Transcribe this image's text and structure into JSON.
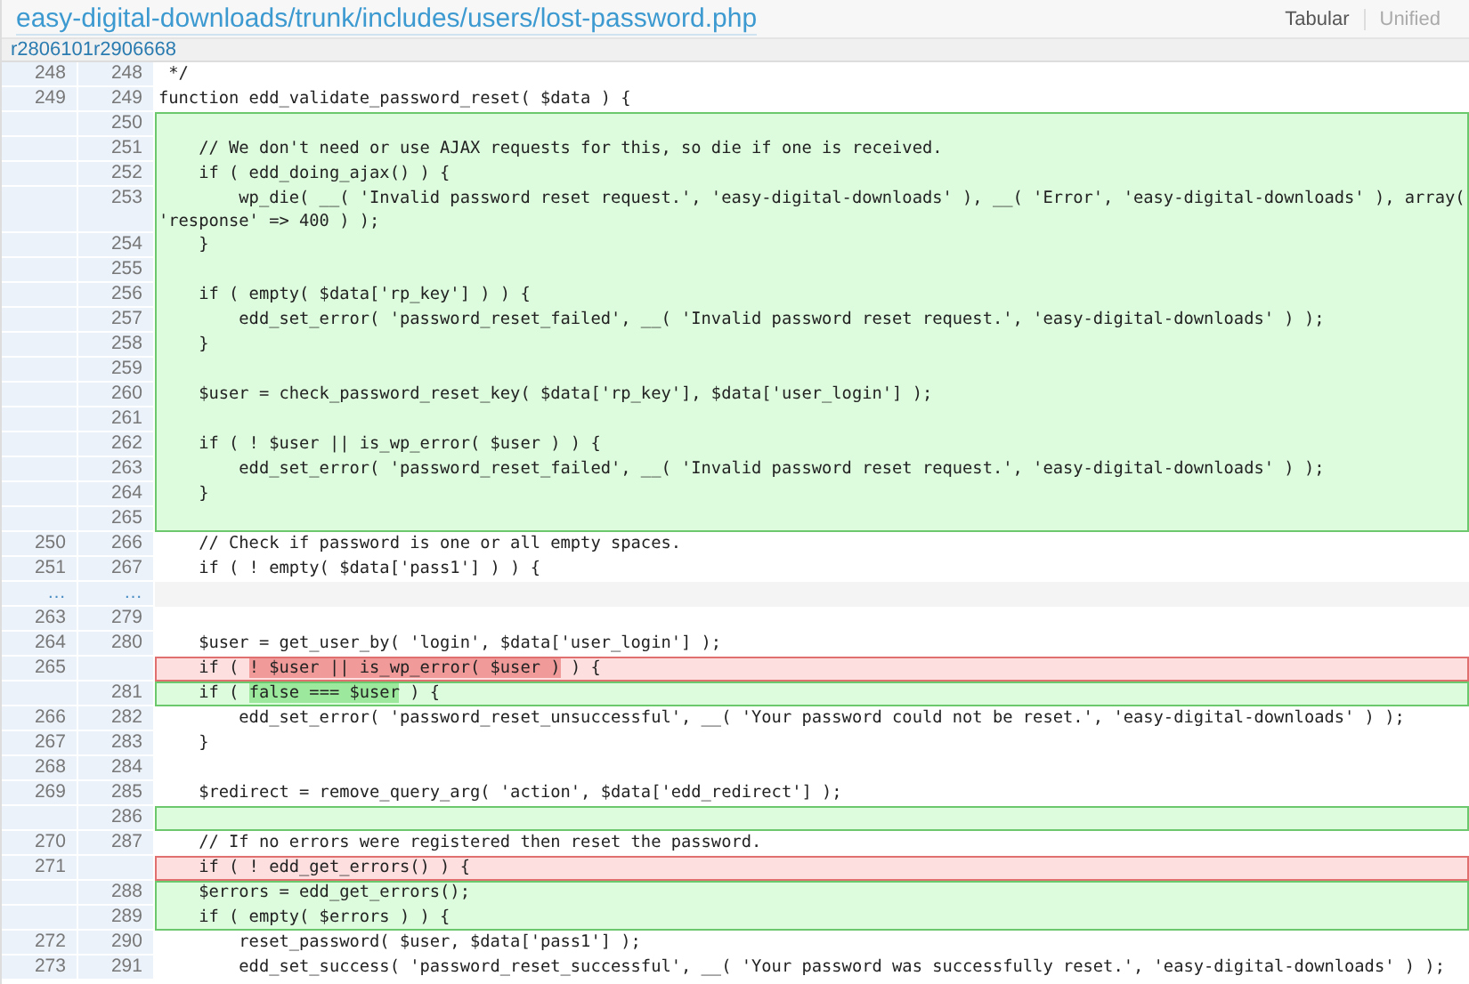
{
  "header": {
    "path": "easy-digital-downloads/trunk/includes/users/lost-password.php",
    "views": [
      {
        "label": "Tabular",
        "selected": true
      },
      {
        "label": "Unified",
        "selected": false
      }
    ]
  },
  "revisions": {
    "old": "r2806101",
    "new": "r2906668"
  },
  "lines": [
    {
      "kind": "context",
      "old": "248",
      "new": "248",
      "code": " */"
    },
    {
      "kind": "context",
      "old": "249",
      "new": "249",
      "code": "function edd_validate_password_reset( $data ) {"
    },
    {
      "kind": "add",
      "new": "250"
    },
    {
      "kind": "add",
      "new": "251",
      "code": "    // We don't need or use AJAX requests for this, so die if one is received."
    },
    {
      "kind": "add",
      "new": "252",
      "code": "    if ( edd_doing_ajax() ) {"
    },
    {
      "kind": "add",
      "new": "253",
      "code": "        wp_die( __( 'Invalid password reset request.', 'easy-digital-downloads' ), __( 'Error', 'easy-digital-downloads' ), array( 'response' => 400 ) );"
    },
    {
      "kind": "add",
      "new": "254",
      "code": "    }"
    },
    {
      "kind": "add",
      "new": "255"
    },
    {
      "kind": "add",
      "new": "256",
      "code": "    if ( empty( $data['rp_key'] ) ) {"
    },
    {
      "kind": "add",
      "new": "257",
      "code": "        edd_set_error( 'password_reset_failed', __( 'Invalid password reset request.', 'easy-digital-downloads' ) );"
    },
    {
      "kind": "add",
      "new": "258",
      "code": "    }"
    },
    {
      "kind": "add",
      "new": "259"
    },
    {
      "kind": "add",
      "new": "260",
      "code": "    $user = check_password_reset_key( $data['rp_key'], $data['user_login'] );"
    },
    {
      "kind": "add",
      "new": "261"
    },
    {
      "kind": "add",
      "new": "262",
      "code": "    if ( ! $user || is_wp_error( $user ) ) {"
    },
    {
      "kind": "add",
      "new": "263",
      "code": "        edd_set_error( 'password_reset_failed', __( 'Invalid password reset request.', 'easy-digital-downloads' ) );"
    },
    {
      "kind": "add",
      "new": "264",
      "code": "    }"
    },
    {
      "kind": "add",
      "new": "265"
    },
    {
      "kind": "context",
      "old": "250",
      "new": "266",
      "code": "    // Check if password is one or all empty spaces."
    },
    {
      "kind": "context",
      "old": "251",
      "new": "267",
      "code": "    if ( ! empty( $data['pass1'] ) ) {"
    },
    {
      "kind": "skip",
      "old": "…",
      "new": "…"
    },
    {
      "kind": "context",
      "old": "263",
      "new": "279"
    },
    {
      "kind": "context",
      "old": "264",
      "new": "280",
      "code": "    $user = get_user_by( 'login', $data['user_login'] );"
    },
    {
      "kind": "del",
      "old": "265",
      "parts": [
        {
          "text": "    if ( ",
          "changed": false
        },
        {
          "text": "! $user || is_wp_error( $user )",
          "changed": true
        },
        {
          "text": " ) {",
          "changed": false
        }
      ]
    },
    {
      "kind": "add",
      "new": "281",
      "parts": [
        {
          "text": "    if ( ",
          "changed": false
        },
        {
          "text": "false === $user",
          "changed": true
        },
        {
          "text": " ) {",
          "changed": false
        }
      ]
    },
    {
      "kind": "context",
      "old": "266",
      "new": "282",
      "code": "        edd_set_error( 'password_reset_unsuccessful', __( 'Your password could not be reset.', 'easy-digital-downloads' ) );"
    },
    {
      "kind": "context",
      "old": "267",
      "new": "283",
      "code": "    }"
    },
    {
      "kind": "context",
      "old": "268",
      "new": "284"
    },
    {
      "kind": "context",
      "old": "269",
      "new": "285",
      "code": "    $redirect = remove_query_arg( 'action', $data['edd_redirect'] );"
    },
    {
      "kind": "add",
      "new": "286"
    },
    {
      "kind": "context",
      "old": "270",
      "new": "287",
      "code": "    // If no errors were registered then reset the password."
    },
    {
      "kind": "del",
      "old": "271",
      "code": "    if ( ! edd_get_errors() ) {"
    },
    {
      "kind": "add",
      "new": "288",
      "code": "    $errors = edd_get_errors();"
    },
    {
      "kind": "add",
      "new": "289",
      "code": "    if ( empty( $errors ) ) {"
    },
    {
      "kind": "context",
      "old": "272",
      "new": "290",
      "code": "        reset_password( $user, $data['pass1'] );"
    },
    {
      "kind": "context",
      "old": "273",
      "new": "291",
      "code": "        edd_set_success( 'password_reset_successful', __( 'Your password was successfully reset.', 'easy-digital-downloads' ) );"
    }
  ]
}
